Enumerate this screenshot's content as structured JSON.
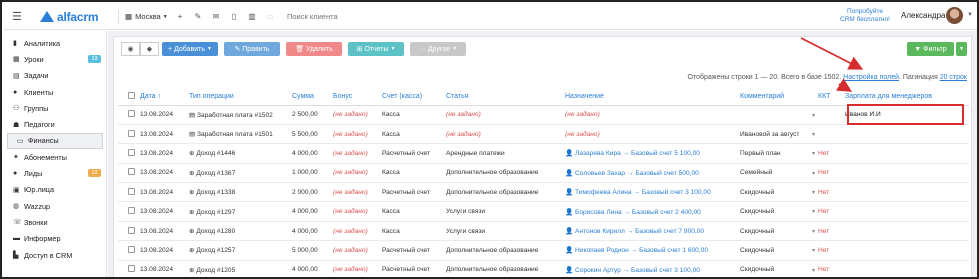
{
  "topbar": {
    "logo": "alfacrm",
    "city": "Москва",
    "search_placeholder": "Поиск клиента",
    "trial": [
      "Попробуйте",
      "CRM бесплатно!"
    ],
    "user": "Александра"
  },
  "sidebar": {
    "items": [
      {
        "label": "Аналитика",
        "icon": "chart-icon"
      },
      {
        "label": "Уроки",
        "icon": "calendar-icon",
        "badge": "13",
        "badge_color": "#5bc0de"
      },
      {
        "label": "Задачи",
        "icon": "tasks-icon"
      },
      {
        "label": "Клиенты",
        "icon": "user-icon"
      },
      {
        "label": "Группы",
        "icon": "group-icon"
      },
      {
        "label": "Педагоги",
        "icon": "teacher-icon"
      },
      {
        "label": "Финансы",
        "icon": "finance-icon",
        "active": true
      },
      {
        "label": "Абонементы",
        "icon": "subscription-icon"
      },
      {
        "label": "Лиды",
        "icon": "leads-icon",
        "badge": "12",
        "badge_color": "#f0ad4e"
      },
      {
        "label": "Юр.лица",
        "icon": "company-icon"
      },
      {
        "label": "Wazzup",
        "icon": "whatsapp-icon"
      },
      {
        "label": "Звонки",
        "icon": "phone-icon"
      },
      {
        "label": "Информер",
        "icon": "informer-icon"
      },
      {
        "label": "Доступ в CRM",
        "icon": "access-icon"
      }
    ]
  },
  "toolbar": {
    "add": "+ Добавить",
    "edit": "✎ Править",
    "delete": "🗑 Удалить",
    "reports": "⊞ Отчеты",
    "other": "··· Другое",
    "filter": "▼ Фильтр"
  },
  "info": {
    "shown": "Отображены строки 1 — 20. Всего в базе 1502.",
    "fields": "Настройка полей",
    "pagination": "Пагинация",
    "per_page": "20 строк"
  },
  "table": {
    "headers": [
      "Дата ↑",
      "Тип операции",
      "Сумма",
      "Бонус",
      "Счет (касса)",
      "Статья",
      "Назначение",
      "Комментарий",
      "ККТ",
      "Зарплата для менеджеров"
    ],
    "rows": [
      {
        "date": "13.08.2024",
        "type": "▤ Заработная плата #1502",
        "sum": "2 500,00",
        "bonus": "(не задано)",
        "account": "Касса",
        "article": "(не задано)",
        "purpose": "(не задано)",
        "comment": "",
        "kkt": "",
        "salary": "Иванов И.И"
      },
      {
        "date": "13.08.2024",
        "type": "▤ Заработная плата #1501",
        "sum": "5 500,00",
        "bonus": "(не задано)",
        "account": "Касса",
        "article": "(не задано)",
        "purpose": "(не задано)",
        "comment": "Ивановой за август",
        "kkt": "",
        "salary": ""
      },
      {
        "date": "13.08.2024",
        "type": "⊕ Доход #1446",
        "sum": "4 000,00",
        "bonus": "(не задано)",
        "account": "Расчетный счет",
        "article": "Арендные платежи",
        "purpose": "👤 Лазарева Кира → Базовый счет 5 100,00",
        "comment": "Первый план",
        "kkt": "Нет",
        "salary": ""
      },
      {
        "date": "13.08.2024",
        "type": "⊕ Доход #1367",
        "sum": "1 000,00",
        "bonus": "(не задано)",
        "account": "Касса",
        "article": "Дополнительное образование",
        "purpose": "👤 Соловьев Захар → Базовый счет 500,00",
        "comment": "Семейный",
        "kkt": "Нет",
        "salary": ""
      },
      {
        "date": "13.08.2024",
        "type": "⊕ Доход #1338",
        "sum": "2 000,00",
        "bonus": "(не задано)",
        "account": "Расчетный счет",
        "article": "Дополнительное образование",
        "purpose": "👤 Тимофеева Алина → Базовый счет 3 100,00",
        "comment": "Скидочный",
        "kkt": "Нет",
        "salary": ""
      },
      {
        "date": "13.08.2024",
        "type": "⊕ Доход #1297",
        "sum": "4 000,00",
        "bonus": "(не задано)",
        "account": "Касса",
        "article": "Услуги связи",
        "purpose": "👤 Борисова Лина → Базовый счет 2 400,00",
        "comment": "Скидочный",
        "kkt": "Нет",
        "salary": ""
      },
      {
        "date": "13.08.2024",
        "type": "⊕ Доход #1280",
        "sum": "4 000,00",
        "bonus": "(не задано)",
        "account": "Касса",
        "article": "Услуги связи",
        "purpose": "👤 Антонов Кирилл → Базовый счет 7 900,00",
        "comment": "Скидочный",
        "kkt": "Нет",
        "salary": ""
      },
      {
        "date": "13.08.2024",
        "type": "⊕ Доход #1257",
        "sum": "5 000,00",
        "bonus": "(не задано)",
        "account": "Расчетный счет",
        "article": "Дополнительное образование",
        "purpose": "👤 Никопаев Родион → Базовый счет 1 600,00",
        "comment": "Скидочный",
        "kkt": "Нет",
        "salary": ""
      },
      {
        "date": "13.08.2024",
        "type": "⊕ Доход #1205",
        "sum": "4 000,00",
        "bonus": "(не задано)",
        "account": "Расчетный счет",
        "article": "Дополнительное образование",
        "purpose": "👤 Сорокин Артур → Базовый счет 3 100,00",
        "comment": "Скидочный",
        "kkt": "Нет",
        "salary": ""
      }
    ]
  },
  "colors": {
    "brand": "#2b7fd6",
    "add": "#4a90d9",
    "edit": "#6fa8dc",
    "delete": "#f08a8a",
    "reports": "#5cc2c6",
    "other": "#c8c8c8",
    "filter": "#5cb85c",
    "highlight": "#d62e2e"
  }
}
